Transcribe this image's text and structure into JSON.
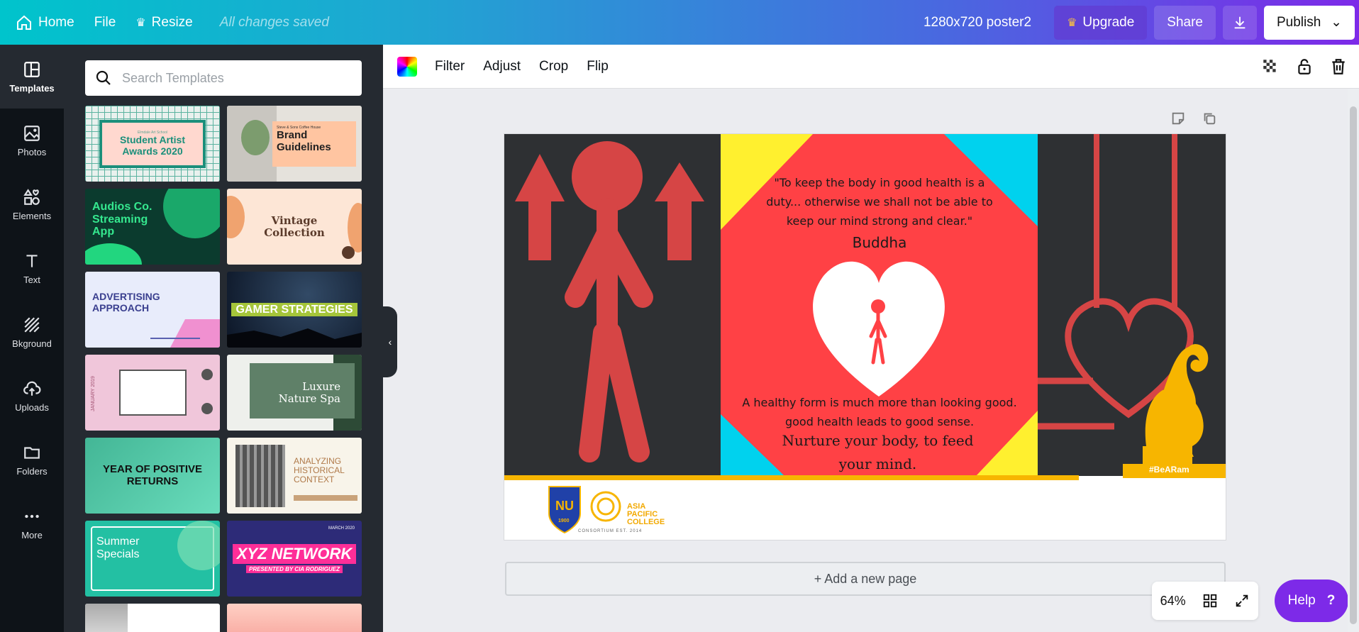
{
  "topbar": {
    "home": "Home",
    "file": "File",
    "resize": "Resize",
    "saved_status": "All changes saved",
    "doc_title": "1280x720 poster2",
    "upgrade": "Upgrade",
    "share": "Share",
    "publish": "Publish"
  },
  "rail": [
    {
      "label": "Templates",
      "icon": "templates-icon"
    },
    {
      "label": "Photos",
      "icon": "photos-icon"
    },
    {
      "label": "Elements",
      "icon": "elements-icon"
    },
    {
      "label": "Text",
      "icon": "text-icon"
    },
    {
      "label": "Bkground",
      "icon": "background-icon"
    },
    {
      "label": "Uploads",
      "icon": "uploads-icon"
    },
    {
      "label": "Folders",
      "icon": "folders-icon"
    },
    {
      "label": "More",
      "icon": "more-icon"
    }
  ],
  "search": {
    "placeholder": "Search Templates"
  },
  "templates": [
    {
      "title": "Student Artist Awards 2020",
      "kicker": "Elmdale Art School"
    },
    {
      "title": "Brand Guidelines",
      "kicker": "Steve & Sons Coffee House"
    },
    {
      "title": "Audios Co. Streaming App",
      "kicker": ""
    },
    {
      "title": "Vintage Collection",
      "kicker": ""
    },
    {
      "title": "ADVERTISING APPROACH",
      "kicker": ""
    },
    {
      "title": "GAMER STRATEGIES",
      "kicker": ""
    },
    {
      "title": "",
      "kicker": "JANUARY 2019"
    },
    {
      "title": "Luxure Nature Spa",
      "kicker": ""
    },
    {
      "title": "YEAR OF POSITIVE RETURNS",
      "kicker": ""
    },
    {
      "title": "ANALYZING HISTORICAL CONTEXT",
      "kicker": ""
    },
    {
      "title": "Summer Specials",
      "kicker": ""
    },
    {
      "title": "XYZ NETWORK",
      "kicker": "MARCH 2020",
      "sub": "PRESENTED BY CIA RODRIGUEZ"
    }
  ],
  "toolbar": {
    "filter": "Filter",
    "adjust": "Adjust",
    "crop": "Crop",
    "flip": "Flip"
  },
  "design": {
    "quote": "\"To keep the body in good health is a duty... otherwise we shall not be able to keep our mind strong and clear.\"",
    "author": "Buddha",
    "body_line": "A healthy form is much more than looking good. good health leads to good sense.",
    "tagline": "Nurture your body, to feed your mind.",
    "hashtag": "#BeARam",
    "logo_caption": "CONSORTIUM EST. 2014",
    "apc_text": "ASIA PACIFIC COLLEGE",
    "nu_text": "1900",
    "colors": {
      "red": "#ff4145",
      "dark": "#2e3033",
      "yellow": "#fff02f",
      "cyan": "#00d2ee",
      "gold": "#f7b500",
      "figure": "#d64545"
    }
  },
  "add_page": "+ Add a new page",
  "zoom": "64%",
  "help": "Help",
  "help_icon": "?"
}
